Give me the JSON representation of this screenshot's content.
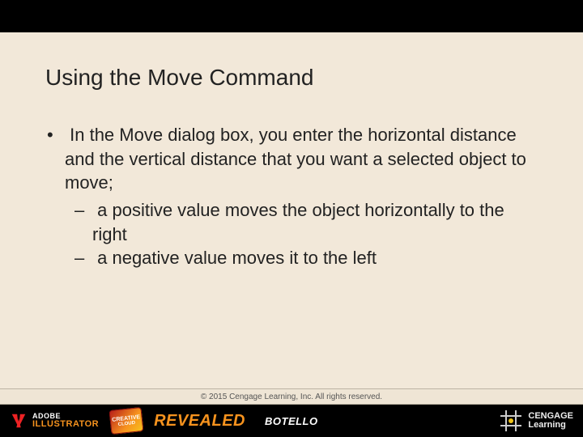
{
  "slide": {
    "title": "Using the Move Command",
    "bullets": [
      {
        "text": "In the Move dialog box, you enter the horizontal distance and the vertical distance that you want a selected object to move;",
        "sub": [
          "a positive value moves the object horizontally to the right",
          "a negative value moves it to the left"
        ]
      }
    ],
    "copyright": "© 2015 Cengage Learning, Inc. All rights reserved."
  },
  "footer": {
    "adobe_line1": "ADOBE",
    "adobe_line2": "ILLUSTRATOR",
    "cc_line1": "CREATIVE",
    "cc_line2": "CLOUD",
    "revealed": "REVEALED",
    "author": "BOTELLO",
    "cengage_line1": "CENGAGE",
    "cengage_line2": "Learning"
  }
}
